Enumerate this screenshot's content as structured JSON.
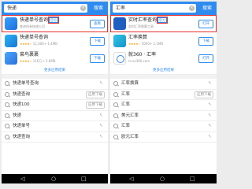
{
  "left": {
    "query": "快递",
    "search_label": "搜索",
    "apps": [
      {
        "name": "快递单号查询",
        "tag": "官方",
        "sub": "查询所有快递公司",
        "btn": "查看"
      },
      {
        "name": "快递单号查询",
        "stars": "★★★★☆",
        "sub": "11,000+ 1.4MB",
        "btn": "下载"
      },
      {
        "name": "菜鸟裹裹",
        "stars": "★★★★☆",
        "sub": "116万+ 2.6MB",
        "btn": "下载"
      }
    ],
    "more": "更多应用结果",
    "rows": [
      {
        "text": "快递单号查询",
        "action": ""
      },
      {
        "text": "快递查询",
        "action": "应用下载"
      },
      {
        "text": "快递100",
        "action": "应用下载"
      },
      {
        "text": "快递",
        "action": ""
      },
      {
        "text": "快递单号",
        "action": ""
      },
      {
        "text": "快递查询",
        "action": ""
      }
    ]
  },
  "right": {
    "query": "汇率",
    "search_label": "搜索",
    "apps": [
      {
        "name": "实时汇率查询",
        "tag": "官方",
        "sub": "实时汇率换算工具",
        "btn": "打开"
      },
      {
        "name": "汇率换算",
        "stars": "★★★★☆",
        "sub": "5000+ 2.1MB",
        "btn": "下载"
      },
      {
        "name": "就360 · 汇率",
        "stars": "",
        "sub": "m.so360.com",
        "btn": "打开"
      }
    ],
    "more": "更多应用结果",
    "rows": [
      {
        "text": "汇率换算",
        "action": ""
      },
      {
        "text": "汇率",
        "action": "应用下载"
      },
      {
        "text": "汇率",
        "action": ""
      },
      {
        "text": "美元汇率",
        "action": ""
      },
      {
        "text": "汇率",
        "action": ""
      },
      {
        "text": "欧元汇率",
        "action": ""
      }
    ]
  },
  "colors": {
    "brand": "#2e8bf0",
    "highlight": "#e62e2e"
  },
  "icons": [
    "search-icon",
    "clear-icon",
    "back-icon",
    "home-icon",
    "recents-icon",
    "arrow-icon"
  ]
}
